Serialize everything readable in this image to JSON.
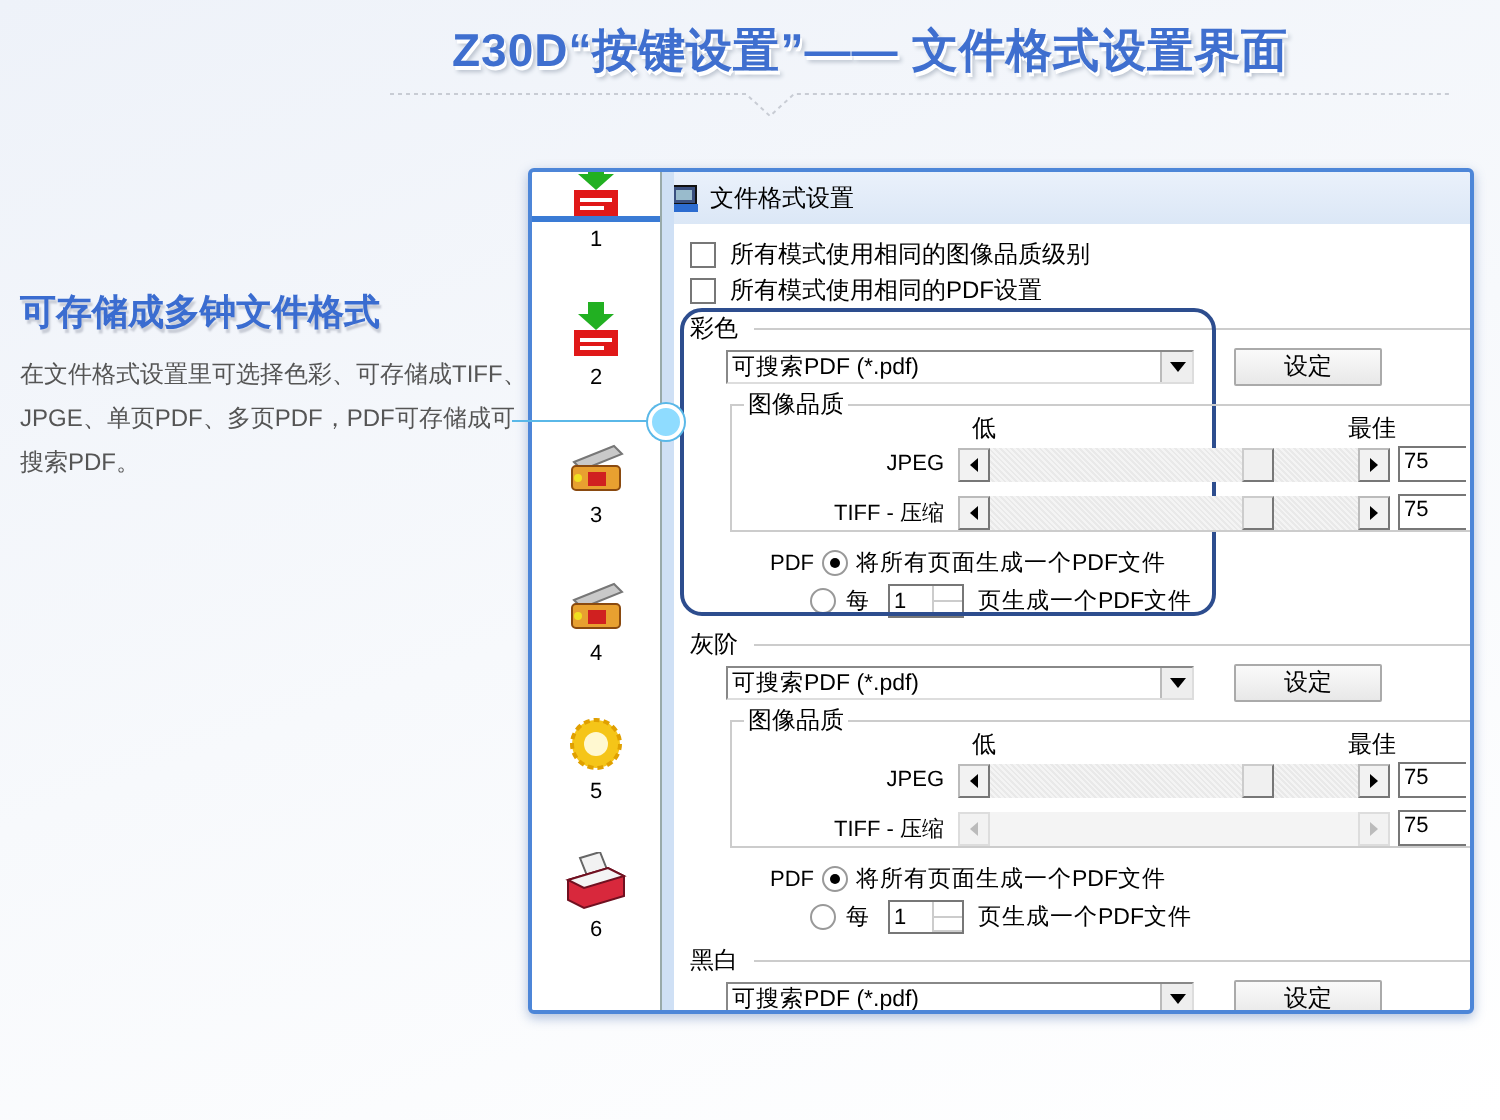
{
  "headline": "Z30D“按键设置”—— 文件格式设置界面",
  "feature": {
    "title": "可存储成多钟文件格式",
    "text": "在文件格式设置里可选择色彩、可存储成TIFF、JPGE、单页PDF、多页PDF，PDF可存储成可搜索PDF。"
  },
  "button_strip": [
    {
      "label": "1",
      "kind": "pdf",
      "selected": true
    },
    {
      "label": "2",
      "kind": "pdf",
      "selected": false
    },
    {
      "label": "3",
      "kind": "scanner",
      "selected": false
    },
    {
      "label": "4",
      "kind": "scanner",
      "selected": false
    },
    {
      "label": "5",
      "kind": "gear",
      "selected": false
    },
    {
      "label": "6",
      "kind": "printer",
      "selected": false
    }
  ],
  "dialog": {
    "title": "文件格式设置",
    "options": [
      {
        "label": "所有模式使用相同的图像品质级别",
        "checked": false
      },
      {
        "label": "所有模式使用相同的PDF设置",
        "checked": false
      }
    ],
    "sections": [
      {
        "title": "彩色",
        "highlighted": true,
        "format": "可搜索PDF (*.pdf)",
        "settings_button": "设定",
        "quality": {
          "title": "图像品质",
          "low": "低",
          "best": "最佳",
          "sliders": [
            {
              "label": "JPEG",
              "disabled": false,
              "level": 0.75,
              "value": "75"
            },
            {
              "label": "TIFF - 压缩",
              "disabled": false,
              "level": 0.75,
              "value": "75"
            }
          ]
        },
        "pdf": {
          "label": "PDF",
          "single": {
            "text": "将所有页面生成一个PDF文件",
            "selected": true
          },
          "every": {
            "prefix": "每",
            "count": "1",
            "text": "页生成一个PDF文件",
            "selected": false
          }
        }
      },
      {
        "title": "灰阶",
        "highlighted": false,
        "format": "可搜索PDF (*.pdf)",
        "settings_button": "设定",
        "quality": {
          "title": "图像品质",
          "low": "低",
          "best": "最佳",
          "sliders": [
            {
              "label": "JPEG",
              "disabled": false,
              "level": 0.75,
              "value": "75"
            },
            {
              "label": "TIFF - 压缩",
              "disabled": true,
              "value": "75"
            }
          ]
        },
        "pdf": {
          "label": "PDF",
          "single": {
            "text": "将所有页面生成一个PDF文件",
            "selected": true
          },
          "every": {
            "prefix": "每",
            "count": "1",
            "text": "页生成一个PDF文件",
            "selected": false
          }
        }
      },
      {
        "title": "黑白",
        "highlighted": false,
        "format": "可搜索PDF (*.pdf)",
        "settings_button": "设定"
      }
    ]
  }
}
